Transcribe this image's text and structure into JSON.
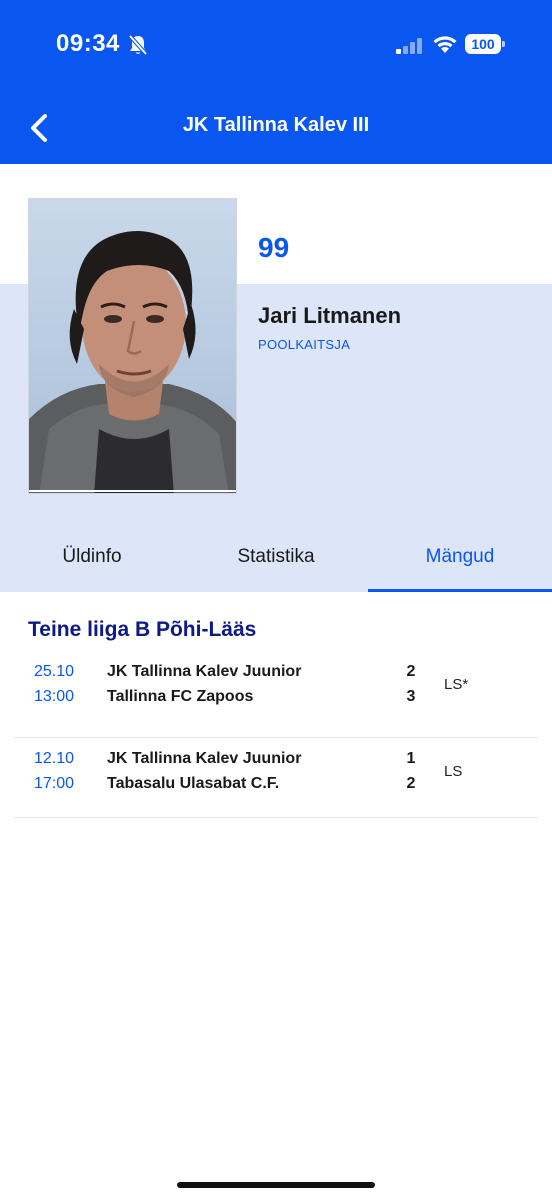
{
  "status_bar": {
    "time": "09:34",
    "battery": "100"
  },
  "header": {
    "title": "JK Tallinna Kalev III"
  },
  "player": {
    "number": "99",
    "name": "Jari Litmanen",
    "position": "POOLKAITSJA"
  },
  "tabs": [
    {
      "label": "Üldinfo",
      "active": false
    },
    {
      "label": "Statistika",
      "active": false
    },
    {
      "label": "Mängud",
      "active": true
    }
  ],
  "league": {
    "name": "Teine liiga B Põhi-Lääs"
  },
  "matches": [
    {
      "date": "25.10",
      "time": "13:00",
      "home": "JK Tallinna Kalev Juunior",
      "away": "Tallinna FC Zapoos",
      "home_score": "2",
      "away_score": "3",
      "tag": "LS*"
    },
    {
      "date": "12.10",
      "time": "17:00",
      "home": "JK Tallinna Kalev Juunior",
      "away": "Tabasalu Ulasabat C.F.",
      "home_score": "1",
      "away_score": "2",
      "tag": "LS"
    }
  ],
  "colors": {
    "accent": "#0a56f0",
    "league_title": "#0b1a86",
    "band": "#dce6f8"
  },
  "icons": {
    "back": "chevron-left-icon",
    "bell": "bell-slash-icon",
    "signal": "signal-icon",
    "wifi": "wifi-icon",
    "battery": "battery-icon"
  }
}
